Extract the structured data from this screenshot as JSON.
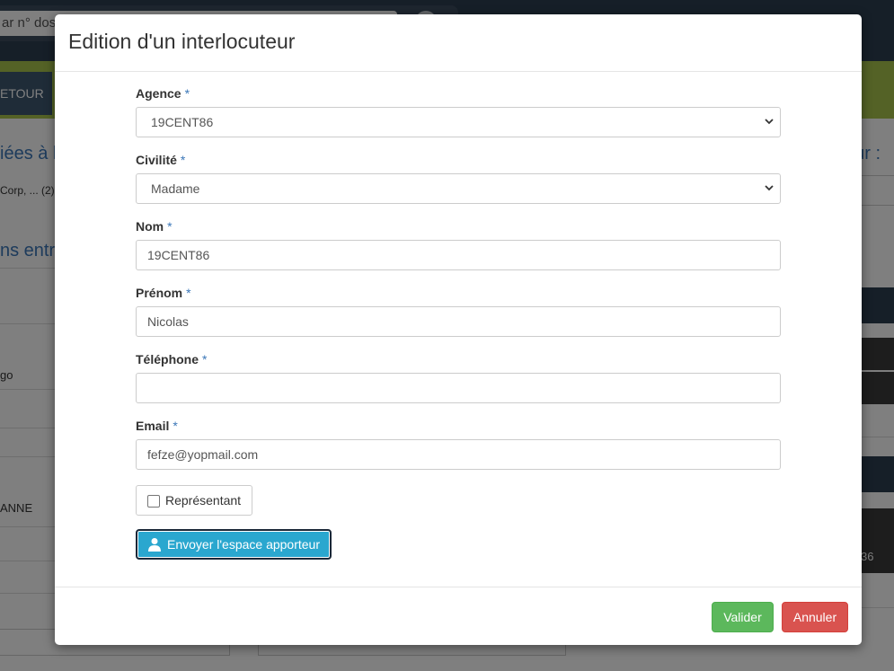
{
  "background": {
    "search_text": "ar n° dos",
    "retour_label": "ETOUR",
    "title_left": "iées à l",
    "title_right": "eur :",
    "subtitle_left": "Corp, ... (2)",
    "title2_left": "ns entr",
    "cell_1": "go",
    "cell_2": "ANNE",
    "right_cell": "36"
  },
  "modal": {
    "title": "Edition d'un interlocuteur",
    "required_mark": "*",
    "fields": [
      {
        "label": "Agence",
        "value": "19CENT86",
        "type": "select"
      },
      {
        "label": "Civilité",
        "value": "Madame",
        "type": "select"
      },
      {
        "label": "Nom",
        "value": "19CENT86",
        "type": "text"
      },
      {
        "label": "Prénom",
        "value": "Nicolas",
        "type": "text"
      },
      {
        "label": "Téléphone",
        "value": "",
        "type": "text"
      },
      {
        "label": "Email",
        "value": "fefze@yopmail.com",
        "type": "text"
      }
    ],
    "checkbox_label": "Représentant",
    "send_button_label": "Envoyer l'espace apporteur",
    "send_button_icon": "user-icon",
    "valider_label": "Valider",
    "annuler_label": "Annuler",
    "colors": {
      "accent": "#3b77b8",
      "send_button": "#2aa7cf",
      "valider": "#5cb85c",
      "annuler": "#d9534f"
    }
  }
}
